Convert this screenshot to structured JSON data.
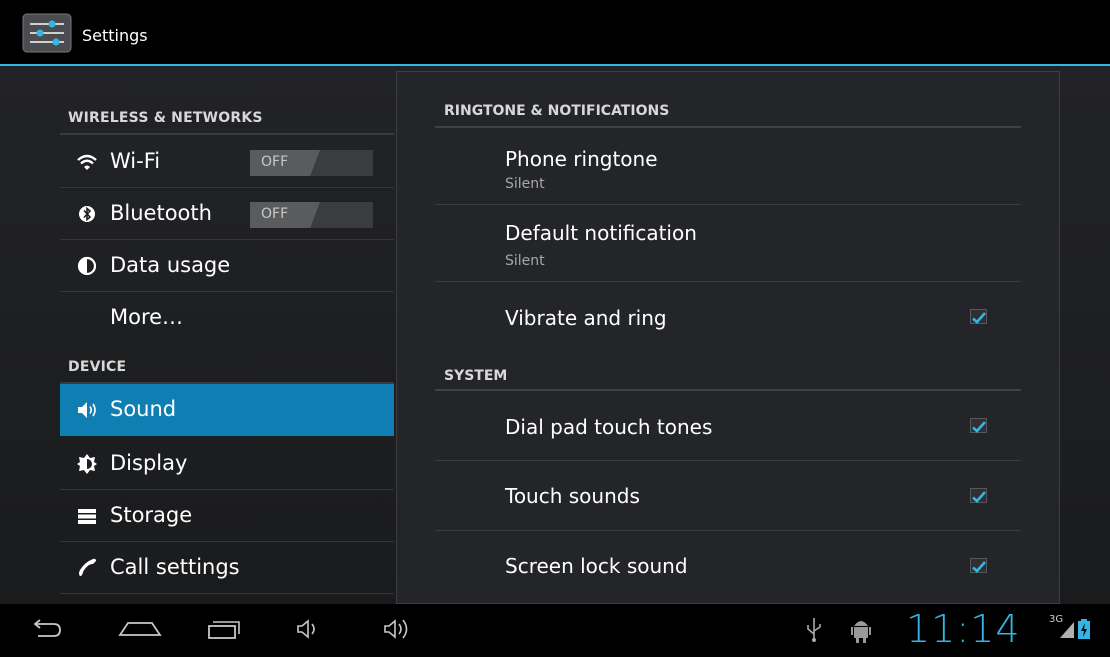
{
  "app": {
    "title": "Settings",
    "icon": "settings-sliders-icon"
  },
  "left_nav": {
    "sections": [
      {
        "header": "WIRELESS & NETWORKS",
        "items": [
          {
            "label": "Wi-Fi",
            "icon": "wifi-icon",
            "toggle": "OFF"
          },
          {
            "label": "Bluetooth",
            "icon": "bluetooth-icon",
            "toggle": "OFF"
          },
          {
            "label": "Data usage",
            "icon": "data-usage-icon"
          },
          {
            "label": "More…"
          }
        ]
      },
      {
        "header": "DEVICE",
        "items": [
          {
            "label": "Sound",
            "icon": "speaker-icon",
            "selected": true
          },
          {
            "label": "Display",
            "icon": "brightness-icon"
          },
          {
            "label": "Storage",
            "icon": "storage-icon"
          },
          {
            "label": "Call settings",
            "icon": "phone-handset-icon"
          }
        ]
      }
    ]
  },
  "sound_panel": {
    "sections": [
      {
        "header": "RINGTONE & NOTIFICATIONS",
        "prefs": [
          {
            "title": "Phone ringtone",
            "summary": "Silent"
          },
          {
            "title": "Default notification",
            "summary": "Silent"
          },
          {
            "title": "Vibrate and ring",
            "checked": true
          }
        ]
      },
      {
        "header": "SYSTEM",
        "prefs": [
          {
            "title": "Dial pad touch tones",
            "checked": true
          },
          {
            "title": "Touch sounds",
            "checked": true
          },
          {
            "title": "Screen lock sound",
            "checked": true
          }
        ]
      }
    ]
  },
  "status_bar": {
    "time": "11:14",
    "network": "3G",
    "icons": [
      "usb-icon",
      "android-debug-icon",
      "signal-icon",
      "battery-charging-icon"
    ]
  },
  "nav_buttons": [
    "back-icon",
    "home-icon",
    "recent-apps-icon",
    "volume-down-icon",
    "volume-up-icon"
  ],
  "colors": {
    "accent": "#33b5e5",
    "selected": "#0f7fb3",
    "check": "#33b5e5"
  }
}
